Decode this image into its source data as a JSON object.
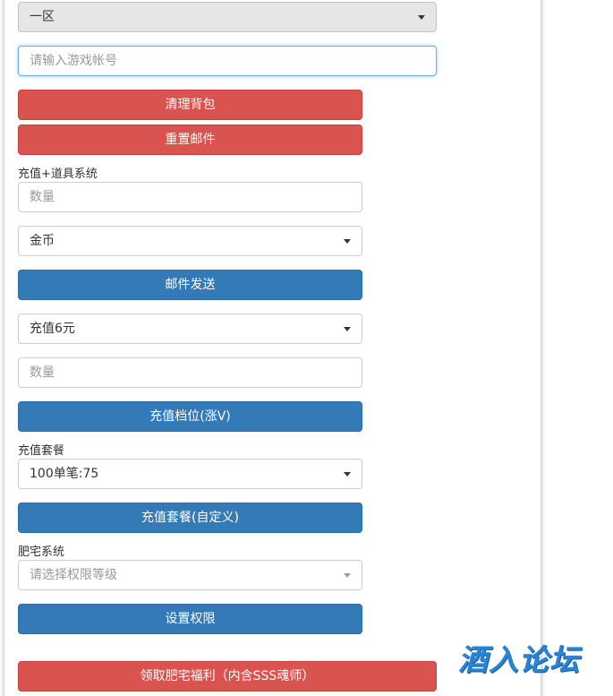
{
  "server_select": {
    "value": "一区"
  },
  "account_input": {
    "placeholder": "请输入游戏帐号"
  },
  "buttons": {
    "clear_bag": "清理背包",
    "reset_mail": "重置邮件",
    "send_mail": "邮件发送",
    "recharge_tier": "充值档位(涨V)",
    "recharge_package_custom": "充值套餐(自定义)",
    "set_permission": "设置权限",
    "claim_welfare": "领取肥宅福利（内含SSS魂师）"
  },
  "recharge_item_section": {
    "label": "充值+道具系统",
    "quantity_placeholder": "数量",
    "item_select_value": "金币"
  },
  "recharge_tier_section": {
    "tier_select_value": "充值6元",
    "quantity_placeholder": "数量"
  },
  "package_section": {
    "label": "充值套餐",
    "package_select_value": "100单笔:75"
  },
  "otaku_section": {
    "label": "肥宅系统",
    "permission_select_placeholder": "请选择权限等级"
  },
  "watermark": {
    "text": "酒入论坛"
  },
  "colors": {
    "danger": "#d9534f",
    "primary": "#337ab7",
    "watermark": "#2a84d6"
  }
}
